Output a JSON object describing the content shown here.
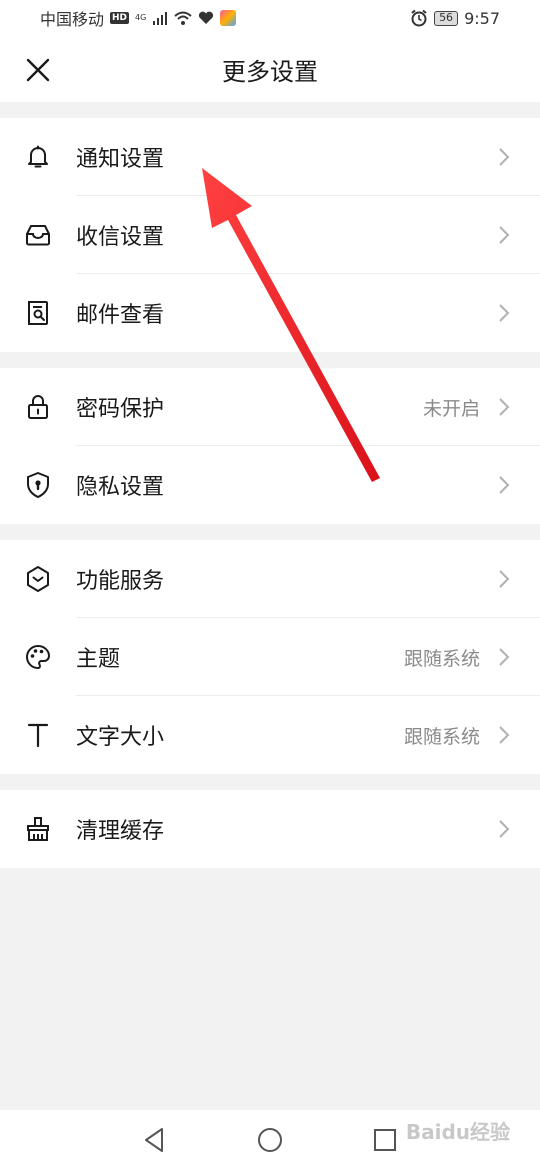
{
  "status_bar": {
    "carrier": "中国移动",
    "hd": "HD",
    "network": "4G",
    "battery": "56",
    "time": "9:57"
  },
  "header": {
    "title": "更多设置",
    "close_icon": "close-icon"
  },
  "groups": [
    {
      "items": [
        {
          "label": "通知设置",
          "value": "",
          "icon": "bell-icon"
        },
        {
          "label": "收信设置",
          "value": "",
          "icon": "inbox-icon"
        },
        {
          "label": "邮件查看",
          "value": "",
          "icon": "mail-view-icon"
        }
      ]
    },
    {
      "items": [
        {
          "label": "密码保护",
          "value": "未开启",
          "icon": "lock-icon"
        },
        {
          "label": "隐私设置",
          "value": "",
          "icon": "shield-icon"
        }
      ]
    },
    {
      "items": [
        {
          "label": "功能服务",
          "value": "",
          "icon": "service-icon"
        },
        {
          "label": "主题",
          "value": "跟随系统",
          "icon": "palette-icon"
        },
        {
          "label": "文字大小",
          "value": "跟随系统",
          "icon": "text-size-icon"
        }
      ]
    },
    {
      "items": [
        {
          "label": "清理缓存",
          "value": "",
          "icon": "broom-icon"
        }
      ]
    }
  ],
  "nav_bar": {
    "back": "back-icon",
    "home": "home-icon",
    "recents": "recents-icon"
  },
  "watermark": "Baidu经验",
  "colors": {
    "background": "#f2f2f2",
    "surface": "#ffffff",
    "text": "#1a1a1a",
    "secondary_text": "#8a8a8a",
    "annotation_arrow": "#e8141c"
  }
}
